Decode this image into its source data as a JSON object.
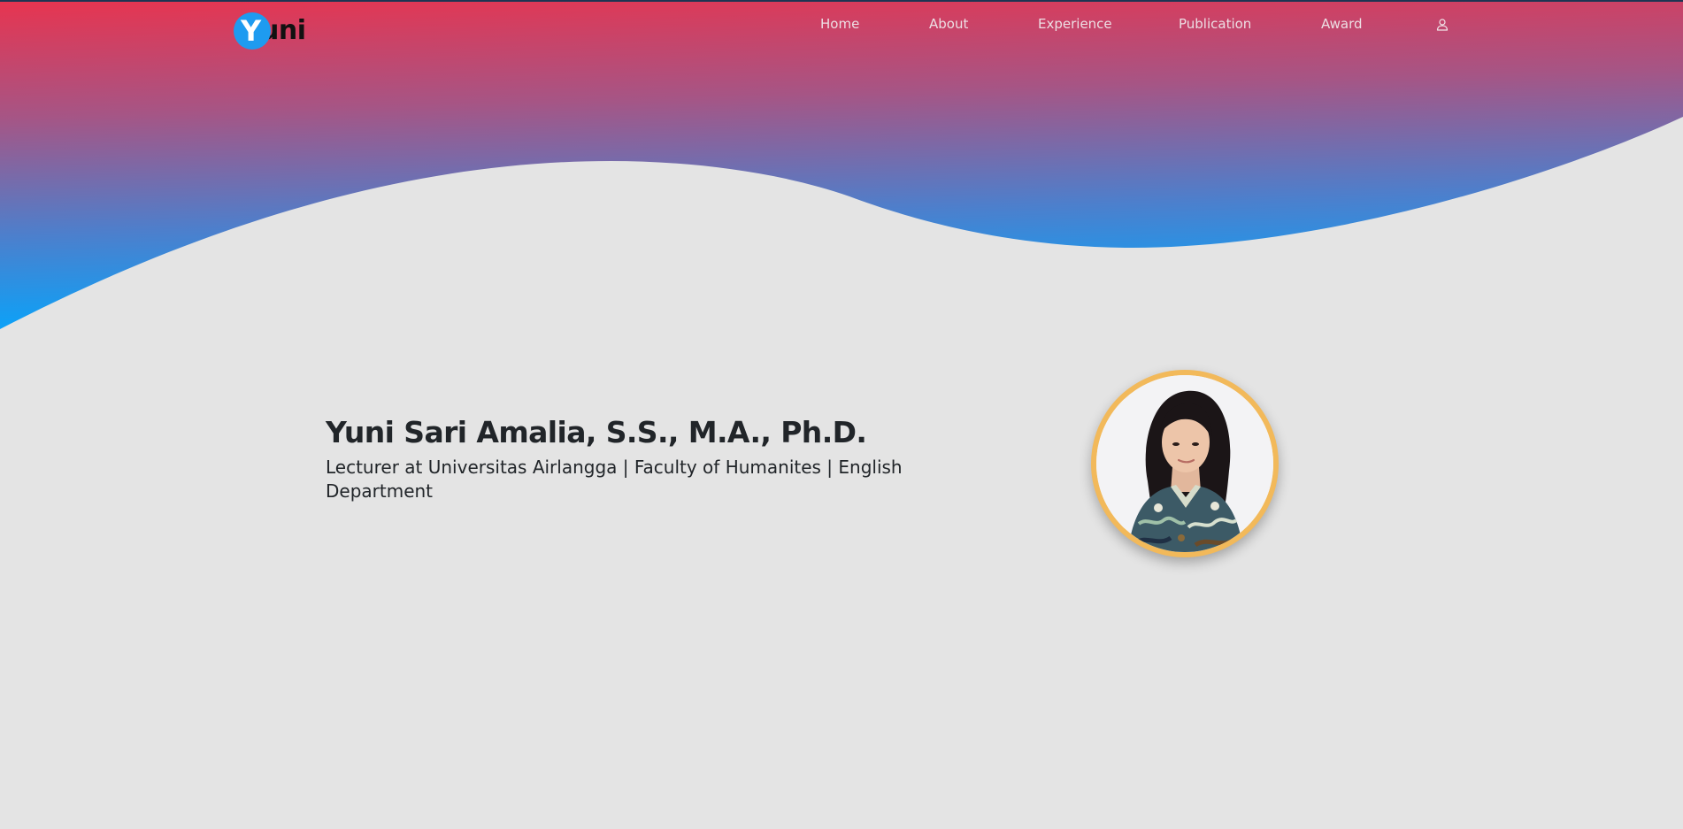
{
  "header": {
    "logo": {
      "initial": "Y",
      "rest": "uni"
    },
    "nav": {
      "items": [
        {
          "label": "Home"
        },
        {
          "label": "About"
        },
        {
          "label": "Experience"
        },
        {
          "label": "Publication"
        },
        {
          "label": "Award"
        }
      ],
      "account_icon": "user-icon"
    }
  },
  "hero": {
    "name": "Yuni Sari Amalia, S.S., M.A., Ph.D.",
    "subtitle": "Lecturer at Universitas Airlangga | Faculty of Humanites | English Department",
    "photo_alt": "profile-photo"
  },
  "colors": {
    "gradient_top": "#e8344f",
    "gradient_bottom": "#0aa1f5",
    "page_background": "#e4e4e4",
    "logo_circle": "#1e9bf0",
    "photo_ring": "#f2b95a",
    "heading_text": "#212529",
    "nav_text": "#eddfe4"
  }
}
